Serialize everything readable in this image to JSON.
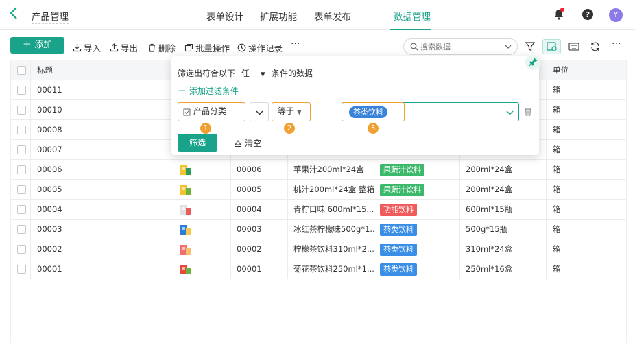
{
  "header": {
    "back_icon": "chevron-left-icon",
    "app_title": "产品管理",
    "tabs": [
      {
        "label": "表单设计"
      },
      {
        "label": "扩展功能"
      },
      {
        "label": "表单发布"
      },
      {
        "label": "数据管理",
        "active": true
      }
    ],
    "avatar_initial": "Y"
  },
  "toolbar": {
    "add_label": "添加",
    "import_label": "导入",
    "export_label": "导出",
    "delete_label": "删除",
    "batch_label": "批量操作",
    "log_label": "操作记录",
    "more_label": "···",
    "search_placeholder": "搜索数据",
    "more_right_label": "···"
  },
  "table": {
    "headers": {
      "title": "标题",
      "unit": "单位"
    },
    "rows": [
      {
        "title": "00011",
        "code": "",
        "name": "",
        "category": "",
        "spec": "",
        "unit": "箱"
      },
      {
        "title": "00010",
        "code": "",
        "name": "",
        "category": "",
        "spec": "",
        "unit": "箱"
      },
      {
        "title": "00008",
        "code": "",
        "name": "",
        "category": "",
        "spec": "",
        "unit": "箱"
      },
      {
        "title": "00007",
        "code": "",
        "name": "",
        "category": "",
        "spec": "",
        "unit": "箱"
      },
      {
        "title": "00006",
        "code": "00006",
        "name": "苹果汁200ml*24盒",
        "category": "果蔬汁饮料",
        "spec": "200ml*24盒",
        "unit": "箱"
      },
      {
        "title": "00005",
        "code": "00005",
        "name": "桃汁200ml*24盒 整箱",
        "category": "果蔬汁饮料",
        "spec": "200ml*24盒",
        "unit": "箱"
      },
      {
        "title": "00004",
        "code": "00004",
        "name": "青柠口味 600ml*15...",
        "category": "功能饮料",
        "spec": "600ml*15瓶",
        "unit": "箱"
      },
      {
        "title": "00003",
        "code": "00003",
        "name": "冰红茶柠檬味500g*1...",
        "category": "茶类饮料",
        "spec": "500g*15瓶",
        "unit": "箱"
      },
      {
        "title": "00002",
        "code": "00002",
        "name": "柠檬茶饮料310ml*2...",
        "category": "茶类饮料",
        "spec": "310ml*24盒",
        "unit": "箱"
      },
      {
        "title": "00001",
        "code": "00001",
        "name": "菊花茶饮料250ml*1...",
        "category": "茶类饮料",
        "spec": "250ml*16盒",
        "unit": "箱"
      }
    ],
    "category_colors": {
      "果蔬汁饮料": "#3cb96b",
      "功能饮料": "#f05a5a",
      "茶类饮料": "#3a8ee6"
    }
  },
  "filter_popup": {
    "prefix": "筛选出符合以下",
    "match_mode": "任一",
    "suffix": "条件的数据",
    "add_condition": "添加过滤条件",
    "field": "产品分类",
    "operator": "等于",
    "value_tag": "茶类饮料",
    "badges": [
      "1",
      "2",
      "3"
    ],
    "filter_button": "筛选",
    "clear_button": "清空"
  },
  "colors": {
    "accent": "#19a38a",
    "highlight": "#f0a030"
  }
}
